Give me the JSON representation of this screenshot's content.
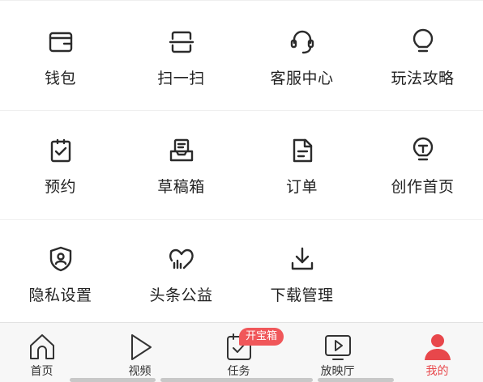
{
  "grid": {
    "rows": [
      [
        {
          "label": "钱包",
          "icon": "wallet-icon"
        },
        {
          "label": "扫一扫",
          "icon": "scan-icon"
        },
        {
          "label": "客服中心",
          "icon": "headset-icon"
        },
        {
          "label": "玩法攻略",
          "icon": "lightbulb-icon"
        }
      ],
      [
        {
          "label": "预约",
          "icon": "clipboard-check-icon"
        },
        {
          "label": "草稿箱",
          "icon": "inbox-tray-icon"
        },
        {
          "label": "订单",
          "icon": "document-icon"
        },
        {
          "label": "创作首页",
          "icon": "bulb-t-icon"
        }
      ],
      [
        {
          "label": "隐私设置",
          "icon": "shield-user-icon"
        },
        {
          "label": "头条公益",
          "icon": "charity-heart-icon"
        },
        {
          "label": "下载管理",
          "icon": "download-icon"
        }
      ]
    ]
  },
  "tabbar": {
    "tabs": [
      {
        "label": "首页",
        "icon": "home-icon"
      },
      {
        "label": "视频",
        "icon": "play-icon"
      },
      {
        "label": "任务",
        "icon": "task-calendar-icon",
        "badge": "开宝箱"
      },
      {
        "label": "放映厅",
        "icon": "screen-play-icon"
      },
      {
        "label": "我的",
        "icon": "user-icon",
        "active": true
      }
    ]
  },
  "colors": {
    "accent": "#e8474b",
    "badge": "#f0575a",
    "icon": "#2b2b2b",
    "tabbar_bg": "#f7f7f7"
  }
}
